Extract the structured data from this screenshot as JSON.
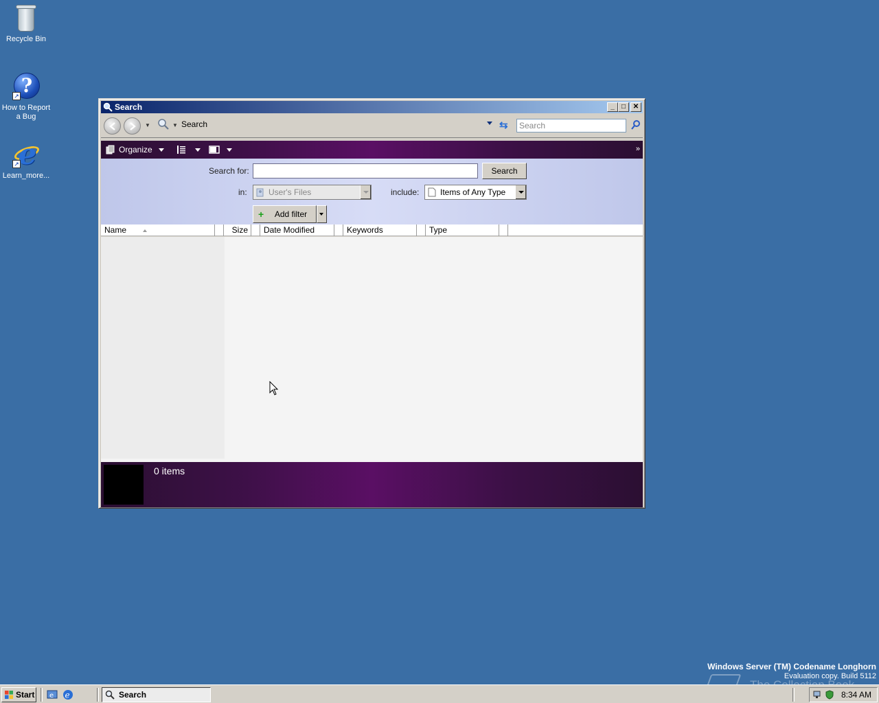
{
  "desktop": {
    "icons": [
      {
        "label": "Recycle Bin"
      },
      {
        "label": "How to Report a Bug"
      },
      {
        "label": "Learn_more..."
      }
    ]
  },
  "window": {
    "title": "Search",
    "title_buttons": {
      "minimize": "_",
      "maximize": "□",
      "close": "✕"
    },
    "address": {
      "crumb": "Search",
      "search_placeholder": "Search"
    },
    "commandbar": {
      "organize_label": "Organize",
      "overflow": "»"
    },
    "search_pane": {
      "search_for_label": "Search for:",
      "search_for_value": "",
      "search_button": "Search",
      "in_label": "in:",
      "in_value": "User's Files",
      "include_label": "include:",
      "include_value": "Items of Any Type",
      "add_filter_label": "Add filter",
      "add_filter_plus": "+"
    },
    "columns": [
      "Name",
      "Size",
      "Date Modified",
      "Keywords",
      "Type"
    ],
    "details": {
      "item_count": "0 items"
    }
  },
  "watermark": {
    "line1": "Windows Server (TM) Codename Longhorn",
    "line2": "Evaluation copy. Build 5112",
    "overlay": "The Collection Book"
  },
  "taskbar": {
    "start_label": "Start",
    "task_label": "Search",
    "clock": "8:34 AM"
  },
  "colors": {
    "desktop": "#3a6ea5",
    "titlebar_start": "#0a246a",
    "titlebar_end": "#a6caf0",
    "commandbar": "#5a0f64",
    "search_pane": "#d7dcf6"
  }
}
